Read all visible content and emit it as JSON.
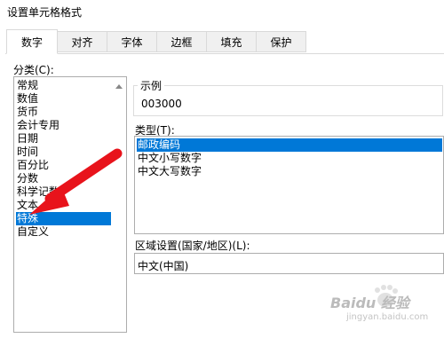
{
  "window": {
    "title": "设置单元格格式"
  },
  "tabs": [
    {
      "label": "数字",
      "active": true
    },
    {
      "label": "对齐"
    },
    {
      "label": "字体"
    },
    {
      "label": "边框"
    },
    {
      "label": "填充"
    },
    {
      "label": "保护"
    }
  ],
  "category": {
    "label": "分类(C):",
    "items": [
      "常规",
      "数值",
      "货币",
      "会计专用",
      "日期",
      "时间",
      "百分比",
      "分数",
      "科学记数",
      "文本",
      "特殊",
      "自定义"
    ],
    "selected": "特殊"
  },
  "sample": {
    "label": "示例",
    "value": "003000"
  },
  "type": {
    "label": "类型(T):",
    "items": [
      "邮政编码",
      "中文小写数字",
      "中文大写数字"
    ],
    "selected": "邮政编码"
  },
  "locale": {
    "label": "区域设置(国家/地区)(L):",
    "value": "中文(中国)"
  },
  "watermark": {
    "brand": "Baidu 经验",
    "url": "jingyan.baidu.com"
  },
  "colors": {
    "selection": "#0078d7",
    "annotation_arrow": "#e8131b"
  },
  "icons": [
    "scroll-up-arrow-icon",
    "scroll-down-arrow-icon",
    "red-arrow-annotation"
  ]
}
